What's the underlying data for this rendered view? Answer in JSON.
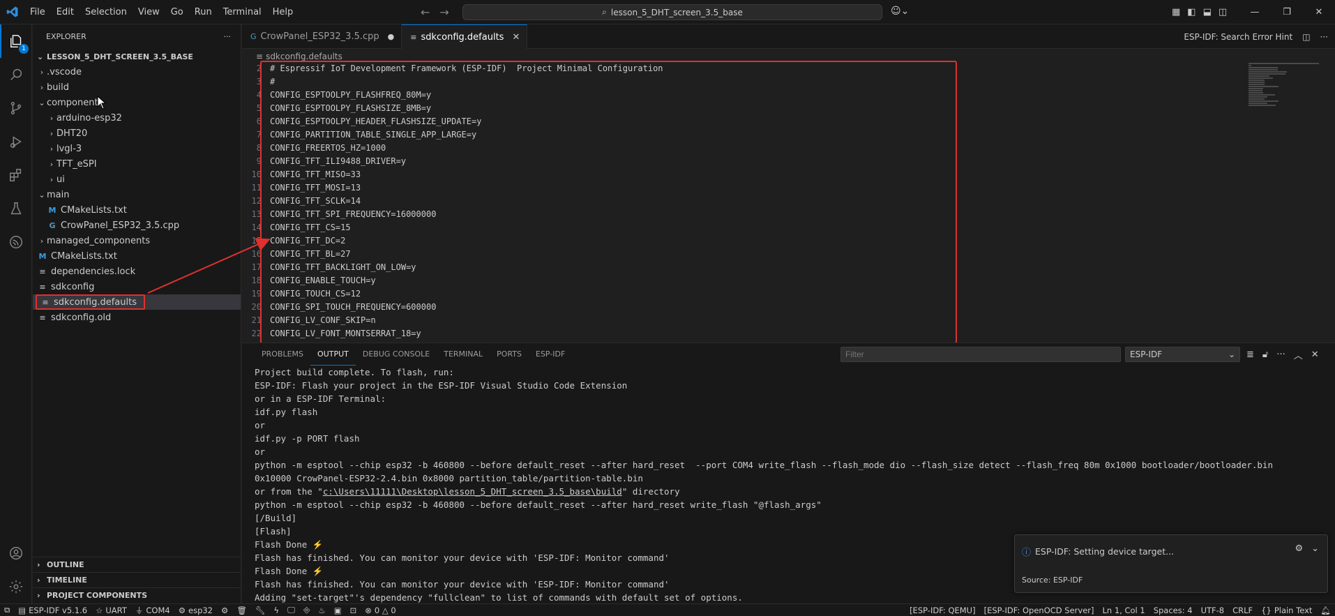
{
  "menu": {
    "items": [
      "File",
      "Edit",
      "Selection",
      "View",
      "Go",
      "Run",
      "Terminal",
      "Help"
    ]
  },
  "command_center": {
    "text": "lesson_5_DHT_screen_3.5_base"
  },
  "activity": {
    "explorer_badge": "1"
  },
  "sidebar": {
    "title": "EXPLORER",
    "root": "LESSON_5_DHT_SCREEN_3.5_BASE",
    "tree": [
      {
        "label": ".vscode"
      },
      {
        "label": "build"
      },
      {
        "label": "components"
      },
      {
        "label": "arduino-esp32"
      },
      {
        "label": "DHT20"
      },
      {
        "label": "lvgl-3"
      },
      {
        "label": "TFT_eSPI"
      },
      {
        "label": "ui"
      },
      {
        "label": "main"
      },
      {
        "label": "CMakeLists.txt"
      },
      {
        "label": "CrowPanel_ESP32_3.5.cpp"
      },
      {
        "label": "managed_components"
      },
      {
        "label": "CMakeLists.txt"
      },
      {
        "label": "dependencies.lock"
      },
      {
        "label": "sdkconfig"
      },
      {
        "label": "sdkconfig.defaults"
      },
      {
        "label": "sdkconfig.old"
      }
    ],
    "sections": [
      "OUTLINE",
      "TIMELINE",
      "PROJECT COMPONENTS"
    ]
  },
  "editor": {
    "tabs": [
      {
        "label": "CrowPanel_ESP32_3.5.cpp"
      },
      {
        "label": "sdkconfig.defaults"
      }
    ],
    "hint": "ESP-IDF: Search Error Hint",
    "breadcrumb": "sdkconfig.defaults",
    "lines": [
      {
        "n": "2",
        "text": "# Espressif IoT Development Framework (ESP-IDF)  Project Minimal Configuration"
      },
      {
        "n": "3",
        "text": "#"
      },
      {
        "n": "4",
        "text": "CONFIG_ESPTOOLPY_FLASHFREQ_80M=y"
      },
      {
        "n": "5",
        "text": "CONFIG_ESPTOOLPY_FLASHSIZE_8MB=y"
      },
      {
        "n": "6",
        "text": "CONFIG_ESPTOOLPY_HEADER_FLASHSIZE_UPDATE=y"
      },
      {
        "n": "7",
        "text": "CONFIG_PARTITION_TABLE_SINGLE_APP_LARGE=y"
      },
      {
        "n": "8",
        "text": "CONFIG_FREERTOS_HZ=1000"
      },
      {
        "n": "9",
        "text": "CONFIG_TFT_ILI9488_DRIVER=y"
      },
      {
        "n": "10",
        "text": "CONFIG_TFT_MISO=33"
      },
      {
        "n": "11",
        "text": "CONFIG_TFT_MOSI=13"
      },
      {
        "n": "12",
        "text": "CONFIG_TFT_SCLK=14"
      },
      {
        "n": "13",
        "text": "CONFIG_TFT_SPI_FREQUENCY=16000000"
      },
      {
        "n": "14",
        "text": "CONFIG_TFT_CS=15"
      },
      {
        "n": "15",
        "text": "CONFIG_TFT_DC=2"
      },
      {
        "n": "16",
        "text": "CONFIG_TFT_BL=27"
      },
      {
        "n": "17",
        "text": "CONFIG_TFT_BACKLIGHT_ON_LOW=y"
      },
      {
        "n": "18",
        "text": "CONFIG_ENABLE_TOUCH=y"
      },
      {
        "n": "19",
        "text": "CONFIG_TOUCH_CS=12"
      },
      {
        "n": "20",
        "text": "CONFIG_SPI_TOUCH_FREQUENCY=600000"
      },
      {
        "n": "21",
        "text": "CONFIG_LV_CONF_SKIP=n"
      },
      {
        "n": "22",
        "text": "CONFIG_LV_FONT_MONTSERRAT_18=y"
      }
    ]
  },
  "panel": {
    "tabs": [
      "PROBLEMS",
      "OUTPUT",
      "DEBUG CONSOLE",
      "TERMINAL",
      "PORTS",
      "ESP-IDF"
    ],
    "filter_placeholder": "Filter",
    "channel": "ESP-IDF",
    "output": [
      "Project build complete. To flash, run:",
      "ESP-IDF: Flash your project in the ESP-IDF Visual Studio Code Extension",
      "or in a ESP-IDF Terminal:",
      "idf.py flash",
      "or",
      "idf.py -p PORT flash",
      "or",
      "python -m esptool --chip esp32 -b 460800 --before default_reset --after hard_reset  --port COM4 write_flash --flash_mode dio --flash_size detect --flash_freq 80m 0x1000 bootloader/bootloader.bin",
      "0x10000 CrowPanel-ESP32-2.4.bin 0x8000 partition_table/partition-table.bin",
      "python -m esptool --chip esp32 -b 460800 --before default_reset --after hard_reset write_flash \"@flash_args\"",
      "[/Build]",
      "[Flash]",
      "Flash Done ⚡️",
      "Flash has finished. You can monitor your device with 'ESP-IDF: Monitor command'",
      "Flash Done ⚡️",
      "Flash has finished. You can monitor your device with 'ESP-IDF: Monitor command'",
      "Adding \"set-target\"'s dependency \"fullclean\" to list of commands with default set of options."
    ],
    "output_dir_prefix": "or from the \"",
    "output_dir_link": "c:\\Users\\11111\\Desktop\\lesson_5_DHT_screen_3.5_base\\build",
    "output_dir_suffix": "\" directory"
  },
  "notification": {
    "message": "ESP-IDF: Setting device target...",
    "source": "Source: ESP-IDF"
  },
  "status": {
    "esp_idf": "ESP-IDF v5.1.6",
    "uart": "UART",
    "port": "COM4",
    "chip": "esp32",
    "problems": "0 △ 0",
    "qemu": "[ESP-IDF: QEMU]",
    "openocd": "[ESP-IDF: OpenOCD Server]",
    "cursor": "Ln 1, Col 1",
    "spaces": "Spaces: 4",
    "encoding": "UTF-8",
    "eol": "CRLF",
    "language": "Plain Text"
  },
  "colors": {
    "accent": "#0078d4",
    "highlight": "#e0312f"
  }
}
